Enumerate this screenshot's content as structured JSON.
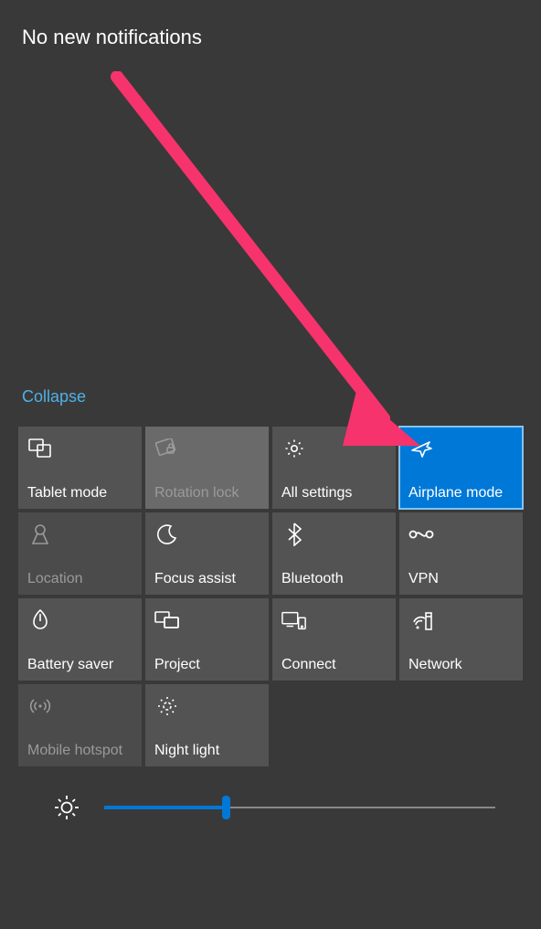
{
  "header": {
    "title": "No new notifications"
  },
  "collapse_label": "Collapse",
  "tiles": [
    {
      "label": "Tablet mode",
      "icon": "tablet-mode-icon",
      "state": "normal"
    },
    {
      "label": "Rotation lock",
      "icon": "rotation-lock-icon",
      "state": "hover-disabled"
    },
    {
      "label": "All settings",
      "icon": "settings-gear-icon",
      "state": "normal"
    },
    {
      "label": "Airplane mode",
      "icon": "airplane-icon",
      "state": "active"
    },
    {
      "label": "Location",
      "icon": "location-icon",
      "state": "disabled"
    },
    {
      "label": "Focus assist",
      "icon": "moon-icon",
      "state": "normal"
    },
    {
      "label": "Bluetooth",
      "icon": "bluetooth-icon",
      "state": "normal"
    },
    {
      "label": "VPN",
      "icon": "vpn-icon",
      "state": "normal"
    },
    {
      "label": "Battery saver",
      "icon": "battery-saver-icon",
      "state": "normal"
    },
    {
      "label": "Project",
      "icon": "project-icon",
      "state": "normal"
    },
    {
      "label": "Connect",
      "icon": "connect-icon",
      "state": "normal"
    },
    {
      "label": "Network",
      "icon": "network-icon",
      "state": "normal"
    },
    {
      "label": "Mobile hotspot",
      "icon": "hotspot-icon",
      "state": "disabled"
    },
    {
      "label": "Night light",
      "icon": "night-light-icon",
      "state": "normal"
    }
  ],
  "brightness": {
    "value_percent": 31
  },
  "annotation": {
    "type": "arrow",
    "color": "#f6336c",
    "target": "airplane-mode-tile"
  }
}
